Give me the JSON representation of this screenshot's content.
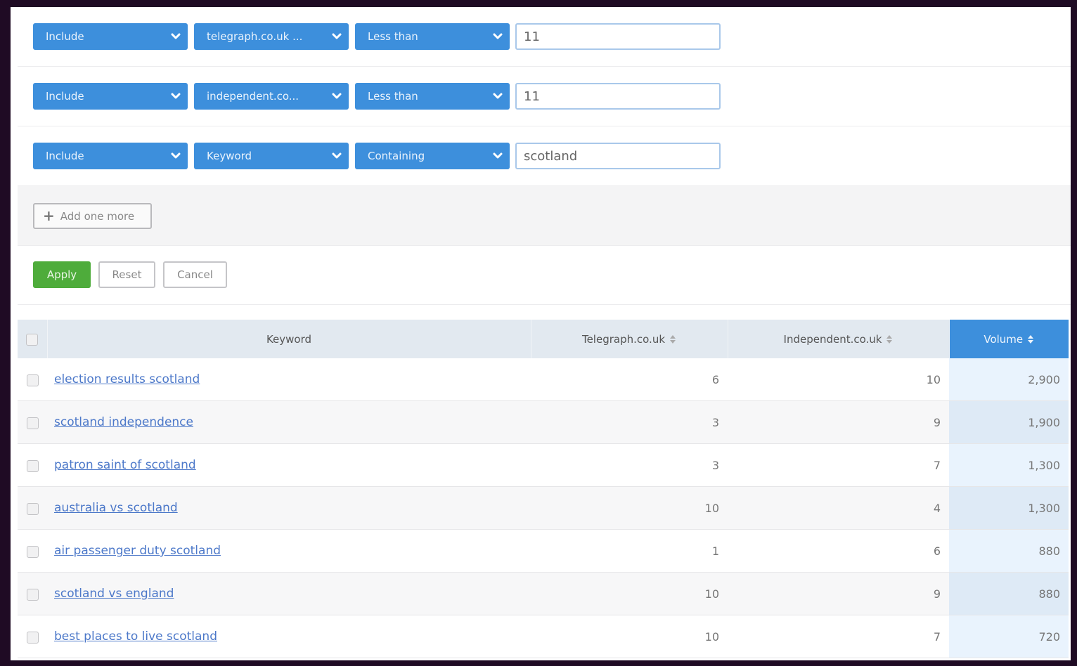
{
  "colors": {
    "accent_blue": "#3d8fdc",
    "apply_green": "#4eac3b",
    "link_blue": "#4c78c9",
    "header_bg": "#e2e9f0",
    "volume_col_bg": "#e9f3fd"
  },
  "filters": [
    {
      "mode": "Include",
      "field": "telegraph.co.uk ...",
      "operator": "Less than",
      "value": "11"
    },
    {
      "mode": "Include",
      "field": "independent.co...",
      "operator": "Less than",
      "value": "11"
    },
    {
      "mode": "Include",
      "field": "Keyword",
      "operator": "Containing",
      "value": "scotland"
    }
  ],
  "add_more": {
    "icon": "plus-icon",
    "label": "Add one more"
  },
  "actions": {
    "apply": "Apply",
    "reset": "Reset",
    "cancel": "Cancel"
  },
  "table": {
    "columns": [
      {
        "label": "Keyword",
        "sortable": false
      },
      {
        "label": "Telegraph.co.uk",
        "sortable": true
      },
      {
        "label": "Independent.co.uk",
        "sortable": true
      },
      {
        "label": "Volume",
        "sortable": true,
        "active": true
      }
    ],
    "rows": [
      {
        "keyword": "election results scotland",
        "telegraph": "6",
        "independent": "10",
        "volume": "2,900"
      },
      {
        "keyword": "scotland independence",
        "telegraph": "3",
        "independent": "9",
        "volume": "1,900"
      },
      {
        "keyword": "patron saint of scotland",
        "telegraph": "3",
        "independent": "7",
        "volume": "1,300"
      },
      {
        "keyword": "australia vs scotland",
        "telegraph": "10",
        "independent": "4",
        "volume": "1,300"
      },
      {
        "keyword": "air passenger duty scotland",
        "telegraph": "1",
        "independent": "6",
        "volume": "880"
      },
      {
        "keyword": "scotland vs england",
        "telegraph": "10",
        "independent": "9",
        "volume": "880"
      },
      {
        "keyword": "best places to live scotland",
        "telegraph": "10",
        "independent": "7",
        "volume": "720"
      }
    ]
  }
}
